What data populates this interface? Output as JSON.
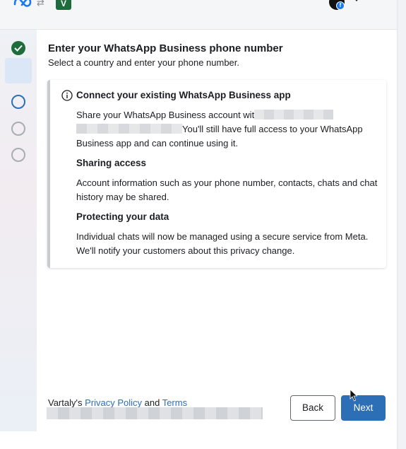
{
  "header": {
    "app_badge": "V",
    "icons": [
      "meta-logo",
      "switch-arrow",
      "facebook-badge",
      "caret-down"
    ]
  },
  "steps": [
    {
      "state": "done"
    },
    {
      "state": "done"
    },
    {
      "state": "current"
    },
    {
      "state": "todo"
    },
    {
      "state": "todo"
    }
  ],
  "page": {
    "title": "Enter your WhatsApp Business phone number",
    "subtitle": "Select a country and enter your phone number."
  },
  "card": {
    "heading": "Connect your existing WhatsApp Business app",
    "intro_part1": "Share your WhatsApp Business account wit",
    "intro_part2": "You'll still have full access to your WhatsApp Business app and can continue using it.",
    "section2_heading": "Sharing access",
    "section2_text": "Account information such as your phone number, contacts, chats and chat history may be shared.",
    "section3_heading": "Protecting your data",
    "section3_text": "Individual chats will now be managed using a secure service from Meta. We'll notify your customers about this privacy change."
  },
  "footer": {
    "prefix": "Vartaly's ",
    "privacy_link": "Privacy Policy",
    "and": " and ",
    "terms_link": "Terms"
  },
  "buttons": {
    "back": "Back",
    "next": "Next"
  },
  "colors": {
    "primary": "#2d6fb6",
    "success": "#1e6b3c",
    "muted": "#a8adb4"
  }
}
